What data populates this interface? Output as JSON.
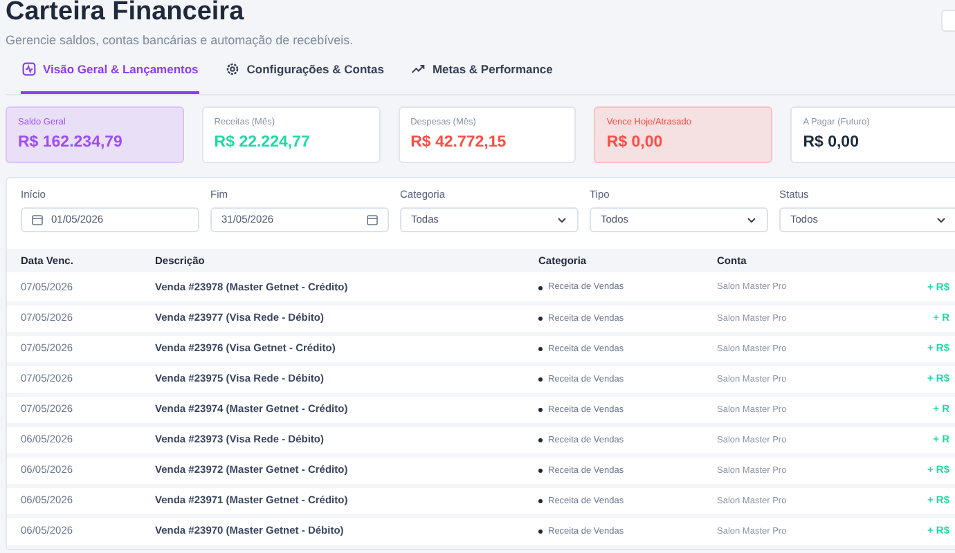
{
  "header": {
    "title": "Carteira Financeira",
    "subtitle": "Gerencie saldos, contas bancárias e automação de recebíveis."
  },
  "tabs": [
    {
      "label": "Visão Geral & Lançamentos",
      "selected": true
    },
    {
      "label": "Configurações & Contas",
      "selected": false
    },
    {
      "label": "Metas & Performance",
      "selected": false
    }
  ],
  "summary_cards": [
    {
      "label": "Saldo Geral",
      "value": "R$ 162.234,79",
      "kind": "highlight",
      "color": "#9b4df5"
    },
    {
      "label": "Receitas (Mês)",
      "value": "R$ 22.224,77",
      "kind": "plain",
      "color": "#1fd9a5"
    },
    {
      "label": "Despesas (Mês)",
      "value": "R$ 42.772,15",
      "kind": "plain",
      "color": "#fb4d44"
    },
    {
      "label": "Vence Hoje/Atrasado",
      "value": "R$ 0,00",
      "kind": "highlight",
      "color": "#fb4d44"
    },
    {
      "label": "A Pagar (Futuro)",
      "value": "R$ 0,00",
      "kind": "plain",
      "color": "#1e2a3b"
    }
  ],
  "filters": [
    {
      "label": "Início",
      "value": "01/05/2026",
      "kind": "date-left"
    },
    {
      "label": "Fim",
      "value": "31/05/2026",
      "kind": "date-right"
    },
    {
      "label": "Categoria",
      "value": "Todas",
      "kind": "select"
    },
    {
      "label": "Tipo",
      "value": "Todos",
      "kind": "select"
    },
    {
      "label": "Status",
      "value": "Todos",
      "kind": "select"
    }
  ],
  "table": {
    "columns": [
      "Data Venc.",
      "Descrição",
      "Categoria",
      "Conta"
    ],
    "rows": [
      {
        "date": "07/05/2026",
        "description": "Venda #23978 (Master Getnet - Crédito)",
        "category": "Receita de Vendas",
        "account": "Salon Master Pro",
        "amount": "+ R$"
      },
      {
        "date": "07/05/2026",
        "description": "Venda #23977 (Visa Rede - Débito)",
        "category": "Receita de Vendas",
        "account": "Salon Master Pro",
        "amount": "+ R"
      },
      {
        "date": "07/05/2026",
        "description": "Venda #23976 (Visa Getnet - Crédito)",
        "category": "Receita de Vendas",
        "account": "Salon Master Pro",
        "amount": "+ R$"
      },
      {
        "date": "07/05/2026",
        "description": "Venda #23975 (Visa Rede - Débito)",
        "category": "Receita de Vendas",
        "account": "Salon Master Pro",
        "amount": "+ R$"
      },
      {
        "date": "07/05/2026",
        "description": "Venda #23974 (Master Getnet - Crédito)",
        "category": "Receita de Vendas",
        "account": "Salon Master Pro",
        "amount": "+ R"
      },
      {
        "date": "06/05/2026",
        "description": "Venda #23973 (Visa Rede - Débito)",
        "category": "Receita de Vendas",
        "account": "Salon Master Pro",
        "amount": "+ R"
      },
      {
        "date": "06/05/2026",
        "description": "Venda #23972 (Master Getnet - Crédito)",
        "category": "Receita de Vendas",
        "account": "Salon Master Pro",
        "amount": "+ R$"
      },
      {
        "date": "06/05/2026",
        "description": "Venda #23971 (Master Getnet - Crédito)",
        "category": "Receita de Vendas",
        "account": "Salon Master Pro",
        "amount": "+ R$"
      },
      {
        "date": "06/05/2026",
        "description": "Venda #23970 (Master Getnet - Débito)",
        "category": "Receita de Vendas",
        "account": "Salon Master Pro",
        "amount": "+ R$"
      }
    ]
  }
}
